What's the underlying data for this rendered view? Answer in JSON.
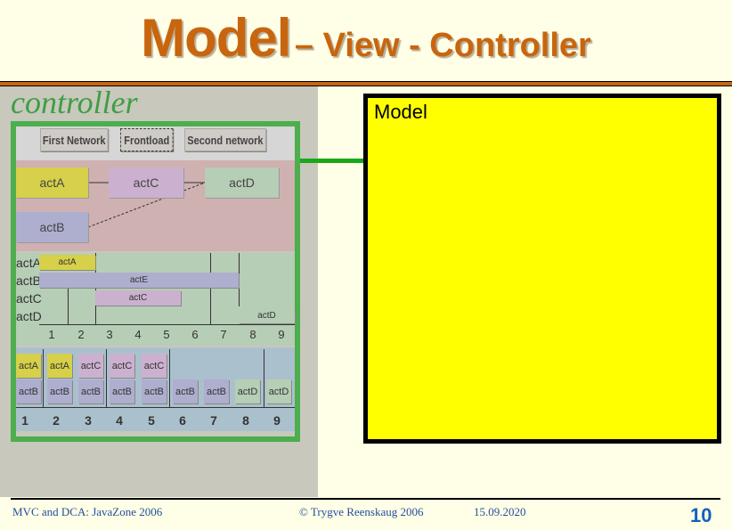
{
  "title": {
    "main": "Model",
    "rest": "– View - Controller"
  },
  "controller": {
    "label": "controller",
    "toolbar": [
      "First Network",
      "Frontload",
      "Second network"
    ],
    "network_nodes": {
      "actA": "actA",
      "actB": "actB",
      "actC": "actC",
      "actD": "actD"
    },
    "gantt": {
      "row_labels": [
        "actA",
        "actB",
        "actC",
        "actD"
      ],
      "bars": [
        "actA",
        "actE",
        "actC",
        "actD"
      ],
      "ticks": [
        "1",
        "2",
        "3",
        "4",
        "5",
        "6",
        "7",
        "8",
        "9"
      ]
    },
    "schedule": {
      "row1": [
        "actA",
        "actA",
        "actC",
        "actC",
        "actC"
      ],
      "row2": [
        "actB",
        "actB",
        "actB",
        "actB",
        "actB",
        "actB",
        "actB",
        "actD",
        "actD"
      ],
      "numbers": [
        "1",
        "2",
        "3",
        "4",
        "5",
        "6",
        "7",
        "8",
        "9"
      ]
    }
  },
  "model": {
    "label": "Model"
  },
  "footer": {
    "left": "MVC and DCA:  JavaZone 2006",
    "center": "© Trygve Reenskaug 2006",
    "date": "15.09.2020",
    "page": "10"
  },
  "colors": {
    "title": "#c8650e",
    "controller_border": "#4cae4c",
    "model_fill": "#ffff00",
    "footer_text": "#2050a0"
  }
}
